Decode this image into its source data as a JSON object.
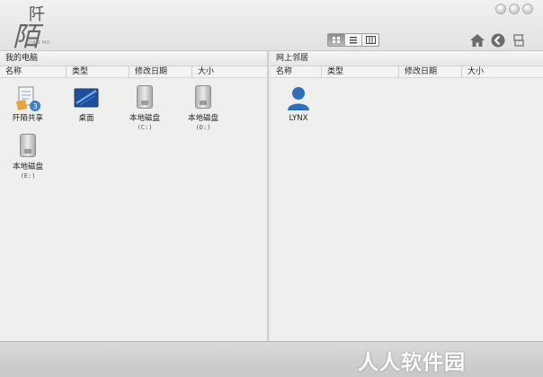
{
  "app": {
    "logo_char_top": "阡",
    "logo_char_main": "陌",
    "logo_sub": "QIAN MO"
  },
  "toolbar": {
    "views": [
      "grid-view-icon",
      "list-view-icon",
      "column-view-icon"
    ],
    "nav": [
      "home-icon",
      "back-icon",
      "refresh-icon"
    ]
  },
  "left_panel": {
    "title": "我的电脑",
    "columns": [
      "名称",
      "类型",
      "修改日期",
      "大小"
    ],
    "items": [
      {
        "label": "阡陌共享",
        "sub": "",
        "icon": "share-icon"
      },
      {
        "label": "桌面",
        "sub": "",
        "icon": "desktop-icon"
      },
      {
        "label": "本地磁盘",
        "sub": "(C:)",
        "icon": "disk-icon"
      },
      {
        "label": "本地磁盘",
        "sub": "(D:)",
        "icon": "disk-icon"
      },
      {
        "label": "本地磁盘",
        "sub": "(E:)",
        "icon": "disk-icon"
      }
    ]
  },
  "right_panel": {
    "title": "网上邻居",
    "columns": [
      "名称",
      "类型",
      "修改日期",
      "大小"
    ],
    "items": [
      {
        "label": "LYNX",
        "icon": "user-icon"
      }
    ]
  },
  "watermark": "人人软件园",
  "colors": {
    "accent_blue": "#2f6fb8",
    "background": "#efefee"
  }
}
